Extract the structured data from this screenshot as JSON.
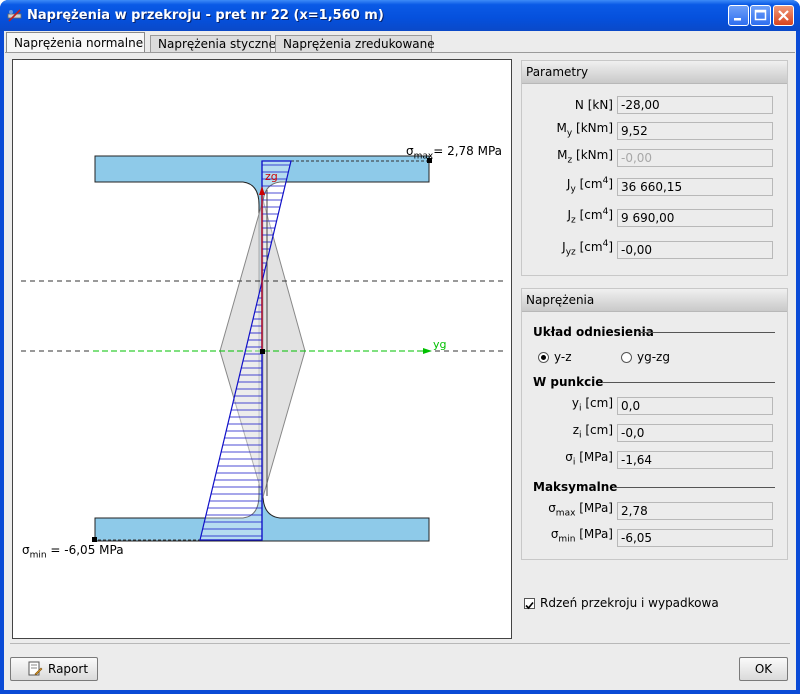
{
  "window": {
    "title": "Naprężenia w przekroju - pret nr 22 (x=1,560 m)",
    "controls": [
      "minimize",
      "maximize",
      "close"
    ]
  },
  "tabs": [
    {
      "label": "Naprężenia normalne",
      "active": true
    },
    {
      "label": "Naprężenia styczne",
      "active": false
    },
    {
      "label": "Naprężenia zredukowane",
      "active": false
    }
  ],
  "diagram": {
    "sigma_max_label": "σ",
    "sigma_max_sub": "max",
    "sigma_max_value": "= 2,78 MPa",
    "sigma_min_label": "σ",
    "sigma_min_sub": "min",
    "sigma_min_value": " = -6,05 MPa",
    "axis_y": "yg",
    "axis_z": "zg"
  },
  "parametry": {
    "title": "Parametry",
    "rows": [
      {
        "label": "N [kN]",
        "value": "-28,00",
        "disabled": false
      },
      {
        "label_main": "M",
        "label_sub": "y",
        "label_rest": " [kNm]",
        "value": "9,52",
        "disabled": false
      },
      {
        "label_main": "M",
        "label_sub": "z",
        "label_rest": " [kNm]",
        "value": "-0,00",
        "disabled": true
      },
      {
        "label_main": "J",
        "label_sub": "y",
        "label_rest": " [cm",
        "label_sup": "4",
        "label_end": "]",
        "value": "36 660,15",
        "disabled": false
      },
      {
        "label_main": "J",
        "label_sub": "z",
        "label_rest": " [cm",
        "label_sup": "4",
        "label_end": "]",
        "value": "9 690,00",
        "disabled": false
      },
      {
        "label_main": "J",
        "label_sub": "yz",
        "label_rest": " [cm",
        "label_sup": "4",
        "label_end": "]",
        "value": "-0,00",
        "disabled": false
      }
    ]
  },
  "naprezenia": {
    "title": "Naprężenia",
    "uklad_title": "Układ odniesienia",
    "radio_yz": "y-z",
    "radio_ygzg": "yg-zg",
    "selected": "y-z",
    "punkt_title": "W punkcie",
    "yi_main": "y",
    "yi_sub": "i",
    "yi_rest": " [cm]",
    "yi_value": "0,0",
    "zi_main": "z",
    "zi_sub": "i",
    "zi_rest": " [cm]",
    "zi_value": "-0,0",
    "si_main": "σ",
    "si_sub": "i",
    "si_rest": " [MPa]",
    "si_value": "-1,64",
    "maks_title": "Maksymalne",
    "smax_main": "σ",
    "smax_sub": "max",
    "smax_rest": " [MPa]",
    "smax_value": "2,78",
    "smin_main": "σ",
    "smin_sub": "min",
    "smin_rest": " [MPa]",
    "smin_value": "-6,05"
  },
  "checkbox": {
    "label": "Rdzeń przekroju i wypadkowa",
    "checked": true
  },
  "buttons": {
    "raport": "Raport",
    "ok": "OK"
  },
  "colors": {
    "section_fill": "#8ecae9",
    "stress_fill": "#0000cc",
    "axis_green": "#00c000",
    "axis_red": "#cc0000",
    "titlebar": "#0550dc"
  }
}
